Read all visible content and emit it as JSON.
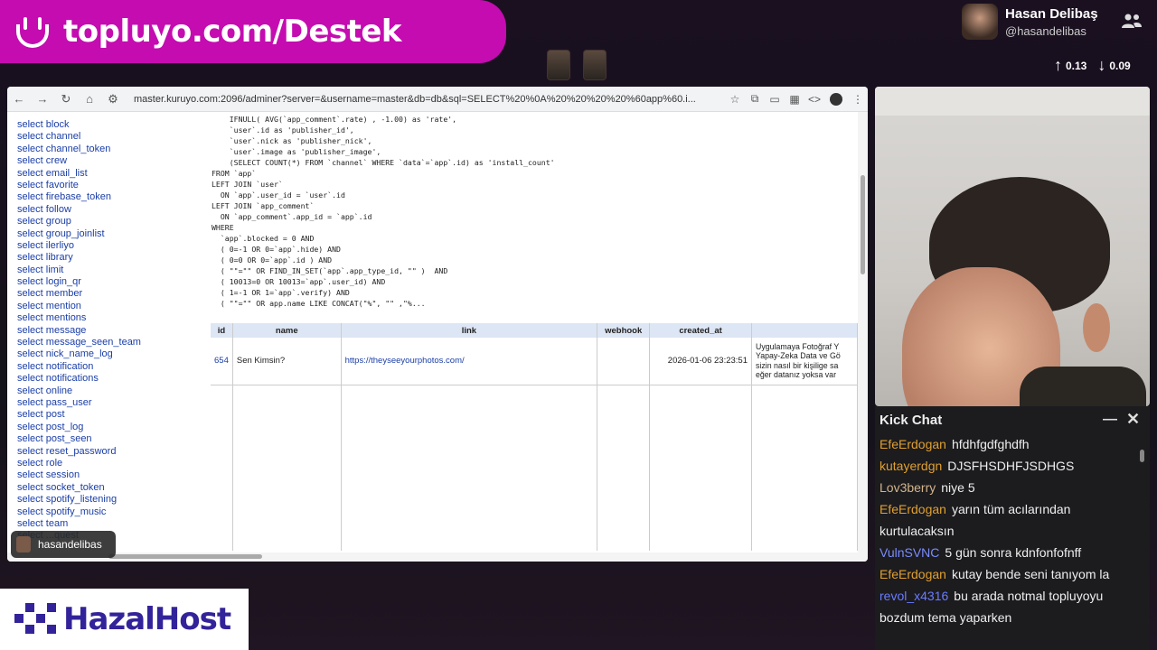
{
  "banner": {
    "text": "topluyo.com/Destek"
  },
  "profile": {
    "name": "Hasan Delibaş",
    "handle": "@hasandelibas"
  },
  "speed": {
    "up": "0.13",
    "down": "0.09"
  },
  "browser": {
    "url": "master.kuruyo.com:2096/adminer?server=&username=master&db=db&sql=SELECT%20%0A%20%20%20%20%60app%60.i...",
    "sidebar": [
      "select block",
      "select channel",
      "select channel_token",
      "select crew",
      "select email_list",
      "select favorite",
      "select firebase_token",
      "select follow",
      "select group",
      "select group_joinlist",
      "select ilerliyo",
      "select library",
      "select limit",
      "select login_qr",
      "select member",
      "select mention",
      "select mentions",
      "select message",
      "select message_seen_team",
      "select nick_name_log",
      "select notification",
      "select notifications",
      "select online",
      "select pass_user",
      "select post",
      "select post_log",
      "select post_seen",
      "select reset_password",
      "select role",
      "select session",
      "select socket_token",
      "select spotify_listening",
      "select spotify_music",
      "select team",
      "select ...quest"
    ],
    "sql_lines": [
      "    IFNULL( AVG(`app_comment`.rate) , -1.00) as 'rate',",
      "    `user`.id as 'publisher_id',",
      "    `user`.nick as 'publisher_nick',",
      "    `user`.image as 'publisher_image',",
      "    (SELECT COUNT(*) FROM `channel` WHERE `data`=`app`.id) as 'install_count'",
      "FROM `app`",
      "LEFT JOIN `user`",
      "  ON `app`.user_id = `user`.id",
      "LEFT JOIN `app_comment`",
      "  ON `app_comment`.app_id = `app`.id",
      "WHERE",
      "  `app`.blocked = 0 AND",
      "  ( 0=-1 OR 0=`app`.hide) AND",
      "  ( 0=0 OR 0=`app`.id ) AND",
      "  ( \"\"=\"\" OR FIND_IN_SET(`app`.app_type_id, \"\" )  AND",
      "  ( 10013=0 OR 10013=`app`.user_id) AND",
      "  ( 1=-1 OR 1=`app`.verify) AND",
      "  ( \"\"=\"\" OR app.name LIKE CONCAT(\"%\", \"\" ,\"%..."
    ],
    "table": {
      "headers": [
        "id",
        "name",
        "link",
        "webhook",
        "created_at",
        ""
      ],
      "row": {
        "id": "654",
        "name": "Sen Kimsin?",
        "link": "https://theyseeyourphotos.com/",
        "webhook": "",
        "created_at": "2026-01-06 23:23:51",
        "desc": [
          "Uygulamaya Fotoğraf Y",
          "Yapay-Zeka Data ve Gö",
          "sizin nasıl bir kişilige sa",
          "eğer datanız yoksa var"
        ]
      }
    }
  },
  "user_tag": "hasandelibas",
  "chat": {
    "title": "Kick Chat",
    "messages": [
      {
        "user": "EfeErdogan",
        "color": "#e0a030",
        "text": "hfdhfgdfghdfh"
      },
      {
        "user": "kutayerdgn",
        "color": "#e0a030",
        "text": "DJSFHSDHFJSDHGS"
      },
      {
        "user": "Lov3berry",
        "color": "#d2b48c",
        "text": "niye 5"
      },
      {
        "user": "EfeErdogan",
        "color": "#e0a030",
        "text": "yarın tüm acılarından kurtulacaksın"
      },
      {
        "user": "VulnSVNC",
        "color": "#7a8cff",
        "text": "5 gün sonra kdnfonfofnff"
      },
      {
        "user": "EfeErdogan",
        "color": "#e0a030",
        "text": "kutay bende seni tanıyom la"
      },
      {
        "user": "revol_x4316",
        "color": "#6a7cff",
        "text": "bu arada notmal topluyoyu bozdum tema yaparken"
      }
    ]
  },
  "logo": {
    "text": "HazalHost",
    "color": "#33239a"
  }
}
